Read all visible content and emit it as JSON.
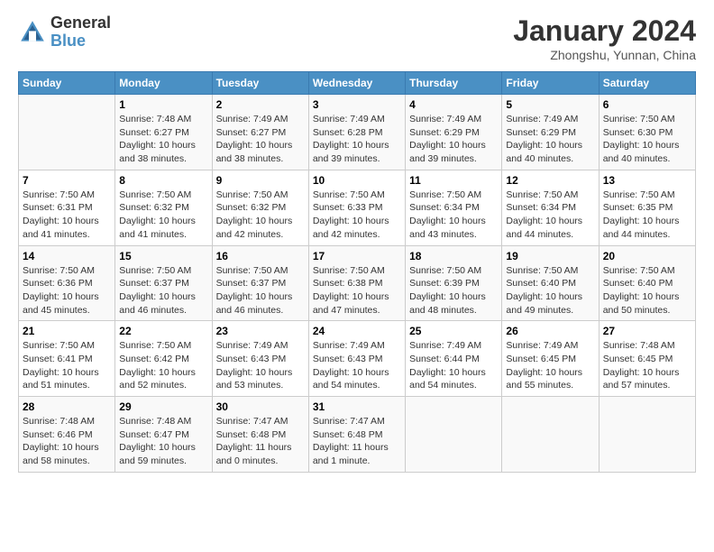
{
  "header": {
    "logo_general": "General",
    "logo_blue": "Blue",
    "main_title": "January 2024",
    "subtitle": "Zhongshu, Yunnan, China"
  },
  "calendar": {
    "headers": [
      "Sunday",
      "Monday",
      "Tuesday",
      "Wednesday",
      "Thursday",
      "Friday",
      "Saturday"
    ],
    "weeks": [
      [
        {
          "day": "",
          "info": ""
        },
        {
          "day": "1",
          "info": "Sunrise: 7:48 AM\nSunset: 6:27 PM\nDaylight: 10 hours\nand 38 minutes."
        },
        {
          "day": "2",
          "info": "Sunrise: 7:49 AM\nSunset: 6:27 PM\nDaylight: 10 hours\nand 38 minutes."
        },
        {
          "day": "3",
          "info": "Sunrise: 7:49 AM\nSunset: 6:28 PM\nDaylight: 10 hours\nand 39 minutes."
        },
        {
          "day": "4",
          "info": "Sunrise: 7:49 AM\nSunset: 6:29 PM\nDaylight: 10 hours\nand 39 minutes."
        },
        {
          "day": "5",
          "info": "Sunrise: 7:49 AM\nSunset: 6:29 PM\nDaylight: 10 hours\nand 40 minutes."
        },
        {
          "day": "6",
          "info": "Sunrise: 7:50 AM\nSunset: 6:30 PM\nDaylight: 10 hours\nand 40 minutes."
        }
      ],
      [
        {
          "day": "7",
          "info": "Sunrise: 7:50 AM\nSunset: 6:31 PM\nDaylight: 10 hours\nand 41 minutes."
        },
        {
          "day": "8",
          "info": "Sunrise: 7:50 AM\nSunset: 6:32 PM\nDaylight: 10 hours\nand 41 minutes."
        },
        {
          "day": "9",
          "info": "Sunrise: 7:50 AM\nSunset: 6:32 PM\nDaylight: 10 hours\nand 42 minutes."
        },
        {
          "day": "10",
          "info": "Sunrise: 7:50 AM\nSunset: 6:33 PM\nDaylight: 10 hours\nand 42 minutes."
        },
        {
          "day": "11",
          "info": "Sunrise: 7:50 AM\nSunset: 6:34 PM\nDaylight: 10 hours\nand 43 minutes."
        },
        {
          "day": "12",
          "info": "Sunrise: 7:50 AM\nSunset: 6:34 PM\nDaylight: 10 hours\nand 44 minutes."
        },
        {
          "day": "13",
          "info": "Sunrise: 7:50 AM\nSunset: 6:35 PM\nDaylight: 10 hours\nand 44 minutes."
        }
      ],
      [
        {
          "day": "14",
          "info": "Sunrise: 7:50 AM\nSunset: 6:36 PM\nDaylight: 10 hours\nand 45 minutes."
        },
        {
          "day": "15",
          "info": "Sunrise: 7:50 AM\nSunset: 6:37 PM\nDaylight: 10 hours\nand 46 minutes."
        },
        {
          "day": "16",
          "info": "Sunrise: 7:50 AM\nSunset: 6:37 PM\nDaylight: 10 hours\nand 46 minutes."
        },
        {
          "day": "17",
          "info": "Sunrise: 7:50 AM\nSunset: 6:38 PM\nDaylight: 10 hours\nand 47 minutes."
        },
        {
          "day": "18",
          "info": "Sunrise: 7:50 AM\nSunset: 6:39 PM\nDaylight: 10 hours\nand 48 minutes."
        },
        {
          "day": "19",
          "info": "Sunrise: 7:50 AM\nSunset: 6:40 PM\nDaylight: 10 hours\nand 49 minutes."
        },
        {
          "day": "20",
          "info": "Sunrise: 7:50 AM\nSunset: 6:40 PM\nDaylight: 10 hours\nand 50 minutes."
        }
      ],
      [
        {
          "day": "21",
          "info": "Sunrise: 7:50 AM\nSunset: 6:41 PM\nDaylight: 10 hours\nand 51 minutes."
        },
        {
          "day": "22",
          "info": "Sunrise: 7:50 AM\nSunset: 6:42 PM\nDaylight: 10 hours\nand 52 minutes."
        },
        {
          "day": "23",
          "info": "Sunrise: 7:49 AM\nSunset: 6:43 PM\nDaylight: 10 hours\nand 53 minutes."
        },
        {
          "day": "24",
          "info": "Sunrise: 7:49 AM\nSunset: 6:43 PM\nDaylight: 10 hours\nand 54 minutes."
        },
        {
          "day": "25",
          "info": "Sunrise: 7:49 AM\nSunset: 6:44 PM\nDaylight: 10 hours\nand 54 minutes."
        },
        {
          "day": "26",
          "info": "Sunrise: 7:49 AM\nSunset: 6:45 PM\nDaylight: 10 hours\nand 55 minutes."
        },
        {
          "day": "27",
          "info": "Sunrise: 7:48 AM\nSunset: 6:45 PM\nDaylight: 10 hours\nand 57 minutes."
        }
      ],
      [
        {
          "day": "28",
          "info": "Sunrise: 7:48 AM\nSunset: 6:46 PM\nDaylight: 10 hours\nand 58 minutes."
        },
        {
          "day": "29",
          "info": "Sunrise: 7:48 AM\nSunset: 6:47 PM\nDaylight: 10 hours\nand 59 minutes."
        },
        {
          "day": "30",
          "info": "Sunrise: 7:47 AM\nSunset: 6:48 PM\nDaylight: 11 hours\nand 0 minutes."
        },
        {
          "day": "31",
          "info": "Sunrise: 7:47 AM\nSunset: 6:48 PM\nDaylight: 11 hours\nand 1 minute."
        },
        {
          "day": "",
          "info": ""
        },
        {
          "day": "",
          "info": ""
        },
        {
          "day": "",
          "info": ""
        }
      ]
    ]
  }
}
